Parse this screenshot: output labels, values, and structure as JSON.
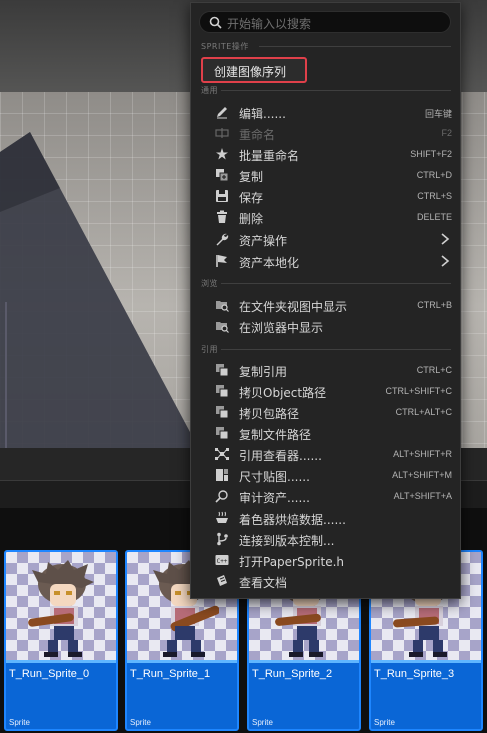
{
  "search": {
    "placeholder": "开始输入以搜索"
  },
  "sections": {
    "sprite": "SPRITE操作",
    "common": "通用",
    "browse": "浏览",
    "reference": "引用"
  },
  "sprite_actions": {
    "create_sequence": "创建图像序列"
  },
  "common_items": [
    {
      "label": "编辑......",
      "shortcut": "回车键",
      "icon": "pencil-icon",
      "disabled": false
    },
    {
      "label": "重命名",
      "shortcut": "F2",
      "icon": "rename-icon",
      "disabled": true
    },
    {
      "label": "批量重命名",
      "shortcut": "SHIFT+F2",
      "icon": "batch-rename-icon",
      "disabled": false
    },
    {
      "label": "复制",
      "shortcut": "CTRL+D",
      "icon": "duplicate-icon",
      "disabled": false
    },
    {
      "label": "保存",
      "shortcut": "CTRL+S",
      "icon": "save-icon",
      "disabled": false
    },
    {
      "label": "删除",
      "shortcut": "DELETE",
      "icon": "trash-icon",
      "disabled": false
    },
    {
      "label": "资产操作",
      "shortcut": "",
      "icon": "wrench-icon",
      "disabled": false
    },
    {
      "label": "资产本地化",
      "shortcut": "",
      "icon": "flag-icon",
      "disabled": false
    }
  ],
  "browse_items": [
    {
      "label": "在文件夹视图中显示",
      "shortcut": "CTRL+B",
      "icon": "folder-search-icon"
    },
    {
      "label": "在浏览器中显示",
      "shortcut": "",
      "icon": "folder-search-icon"
    }
  ],
  "reference_items": [
    {
      "label": "复制引用",
      "shortcut": "CTRL+C",
      "icon": "copy-reference-icon"
    },
    {
      "label": "拷贝Object路径",
      "shortcut": "CTRL+SHIFT+C",
      "icon": "copy-path-icon"
    },
    {
      "label": "拷贝包路径",
      "shortcut": "CTRL+ALT+C",
      "icon": "copy-path-icon"
    },
    {
      "label": "复制文件路径",
      "shortcut": "",
      "icon": "copy-path-icon"
    },
    {
      "label": "引用查看器......",
      "shortcut": "ALT+SHIFT+R",
      "icon": "reference-viewer-icon"
    },
    {
      "label": "尺寸贴图......",
      "shortcut": "ALT+SHIFT+M",
      "icon": "size-map-icon"
    },
    {
      "label": "审计资产......",
      "shortcut": "ALT+SHIFT+A",
      "icon": "audit-icon"
    },
    {
      "label": "着色器烘焙数据......",
      "shortcut": "",
      "icon": "shader-icon"
    },
    {
      "label": "连接到版本控制...",
      "shortcut": "",
      "icon": "source-control-icon"
    },
    {
      "label": "打开PaperSprite.h",
      "shortcut": "",
      "icon": "code-file-icon"
    },
    {
      "label": "查看文档",
      "shortcut": "",
      "icon": "documentation-icon"
    }
  ],
  "assets": [
    {
      "name": "T_Run_Sprite_0",
      "type": "Sprite"
    },
    {
      "name": "T_Run_Sprite_1",
      "type": "Sprite"
    },
    {
      "name": "T_Run_Sprite_2",
      "type": "Sprite"
    },
    {
      "name": "T_Run_Sprite_3",
      "type": "Sprite"
    }
  ],
  "colors": {
    "menu_bg": "#242424",
    "highlight_border": "#e0404a",
    "asset_selected": "#0a66d6"
  }
}
